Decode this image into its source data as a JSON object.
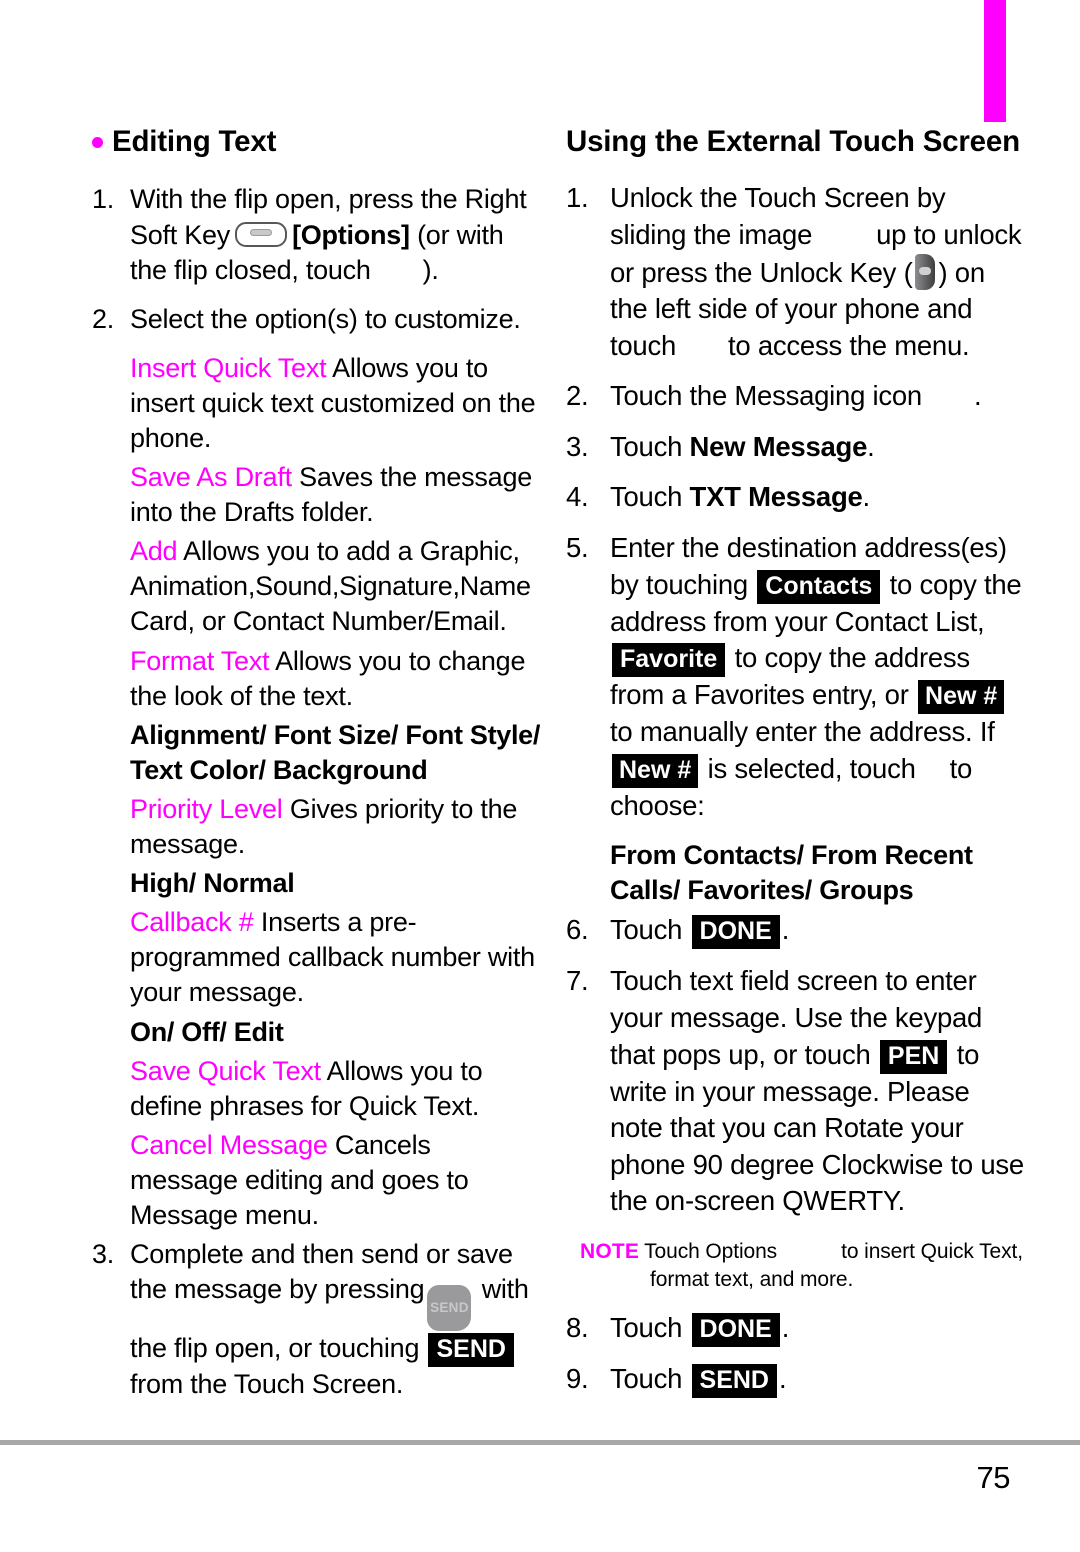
{
  "page": {
    "number": "75",
    "accent_color": "#ff00ff",
    "rule_color": "#a8a8a8"
  },
  "left_column": {
    "heading": "Editing Text",
    "step1": {
      "num": "1.",
      "text_a": "With the flip open, press the Right Soft Key",
      "bracket": "[Options]",
      "text_b": "(or with the flip closed, touch",
      "text_c": ")."
    },
    "step2": {
      "num": "2.",
      "text": "Select the option(s) to customize."
    },
    "options": [
      {
        "term": "Insert Quick Text",
        "description": "Allows you to insert quick text customized on the phone."
      },
      {
        "term": "Save As Draft",
        "description": "Saves the message into the Drafts folder."
      },
      {
        "term": "Add",
        "description": "Allows you to add a Graphic, Animation,Sound,Signature,Name Card, or Contact Number/Email."
      },
      {
        "term": "Format Text",
        "description": "Allows you to change the look of the text.",
        "subhead": "Alignment/ Font Size/ Font Style/ Text Color/ Background"
      },
      {
        "term": "Priority Level",
        "description": "Gives priority to the message.",
        "subhead": "High/ Normal"
      },
      {
        "term": "Callback #",
        "description": "Inserts a pre-programmed callback number with your message.",
        "subhead": "On/ Off/ Edit"
      },
      {
        "term": "Save Quick Text",
        "description": "Allows you to define phrases for Quick Text."
      },
      {
        "term": "Cancel Message",
        "description": "Cancels message editing and goes to Message menu."
      }
    ],
    "step3": {
      "num": "3.",
      "text_a": "Complete and then send or save the message by pressing",
      "text_b": "with the flip open, or touching",
      "badge_send": "SEND",
      "text_c": "from the Touch Screen.",
      "key_send_label": "SEND"
    }
  },
  "right_column": {
    "heading": "Using the External Touch Screen",
    "step1": {
      "num": "1.",
      "text_a": "Unlock the Touch Screen by sliding the image",
      "text_b": "up to unlock or press the Unlock Key (",
      "text_c": ") on the left side of your phone and touch",
      "text_d": "to access the menu."
    },
    "step2": {
      "num": "2.",
      "text_a": "Touch the Messaging icon",
      "text_b": "."
    },
    "step3": {
      "num": "3.",
      "text_a": "Touch",
      "bold": "New Message",
      "text_b": "."
    },
    "step4": {
      "num": "4.",
      "text_a": "Touch",
      "bold": "TXT Message",
      "text_b": "."
    },
    "step5": {
      "num": "5.",
      "text_a": "Enter the destination address(es) by touching",
      "badge_contacts": "Contacts",
      "text_b": "to copy the address from your Contact List,",
      "badge_favorite": "Favorite",
      "text_c": "to copy the address from a Favorites entry, or",
      "badge_new1": "New #",
      "text_d": "to manually enter the address. If",
      "badge_new2": "New #",
      "text_e": "is selected, touch",
      "text_f": "to choose:",
      "subhead": "From Contacts/ From Recent Calls/ Favorites/ Groups"
    },
    "step6": {
      "num": "6.",
      "text_a": "Touch",
      "badge_done": "DONE",
      "text_b": "."
    },
    "step7": {
      "num": "7.",
      "text_a": "Touch text field screen to enter your message. Use the keypad that pops up, or touch",
      "badge_pen": "PEN",
      "text_b": "to write in your message. Please note that you can Rotate your phone 90 degree Clockwise to use the on-screen QWERTY."
    },
    "note": {
      "label": "NOTE",
      "line1": "Touch Options",
      "line1b": "to insert Quick Text,",
      "line2": "format text, and more."
    },
    "step8": {
      "num": "8.",
      "text_a": "Touch",
      "badge_done": "DONE",
      "text_b": "."
    },
    "step9": {
      "num": "9.",
      "text_a": "Touch",
      "badge_send": "SEND",
      "text_b": "."
    }
  }
}
